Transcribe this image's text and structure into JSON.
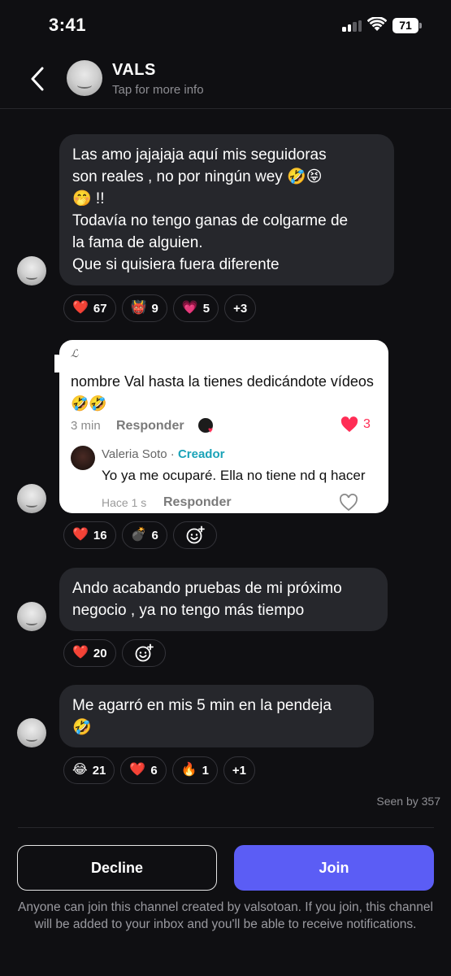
{
  "status_bar": {
    "time": "3:41",
    "battery": "71"
  },
  "header": {
    "title": "VALS",
    "subtitle": "Tap for more info"
  },
  "messages": [
    {
      "lines": [
        "Las amo jajajaja aquí mis seguidoras",
        "son reales , no por ningún wey 🤣😝",
        "🤭 !!",
        "Todavía no tengo ganas de colgarme de",
        "la fama de alguien.",
        "Que si quisiera fuera diferente"
      ],
      "reactions": [
        {
          "emoji": "❤️",
          "count": "67"
        },
        {
          "emoji": "👹",
          "count": "9"
        },
        {
          "emoji": "💗",
          "count": "5"
        },
        {
          "emoji": "",
          "count": "+3"
        }
      ]
    },
    {
      "card": {
        "author_initial": "ℒ",
        "comment_lines": [
          "nombre Val hasta la tienes dedicándote vídeos",
          "🤣🤣"
        ],
        "time": "3 min",
        "reply_label": "Responder",
        "likes": "3",
        "reply": {
          "name": "Valeria Soto",
          "separator": " · ",
          "tag": "Creador",
          "text": "Yo ya me ocuparé. Ella no tiene nd q hacer",
          "time": "Hace 1 s",
          "reply_label": "Responder"
        }
      },
      "reactions": [
        {
          "emoji": "❤️",
          "count": "16"
        },
        {
          "emoji": "💣",
          "count": "6"
        }
      ]
    },
    {
      "lines": [
        "Ando acabando pruebas de mi próximo",
        "negocio , ya no tengo más tiempo"
      ],
      "reactions": [
        {
          "emoji": "❤️",
          "count": "20"
        }
      ]
    },
    {
      "lines": [
        "Me agarró en mis 5 min en la pendeja",
        "🤣"
      ],
      "reactions": [
        {
          "emoji": "😂",
          "count": "21"
        },
        {
          "emoji": "❤️",
          "count": "6"
        },
        {
          "emoji": "🔥",
          "count": "1"
        },
        {
          "emoji": "",
          "count": "+1"
        }
      ]
    }
  ],
  "seen_by": "Seen by 357",
  "actions": {
    "decline": "Decline",
    "join": "Join"
  },
  "footer_note": "Anyone can join this channel created by valsotoan. If you join, this channel will be added to your inbox and you'll be able to receive notifications.",
  "colors": {
    "accent": "#5b5df5",
    "creator_tag": "#1aa3b8",
    "like": "#ff2d55"
  }
}
